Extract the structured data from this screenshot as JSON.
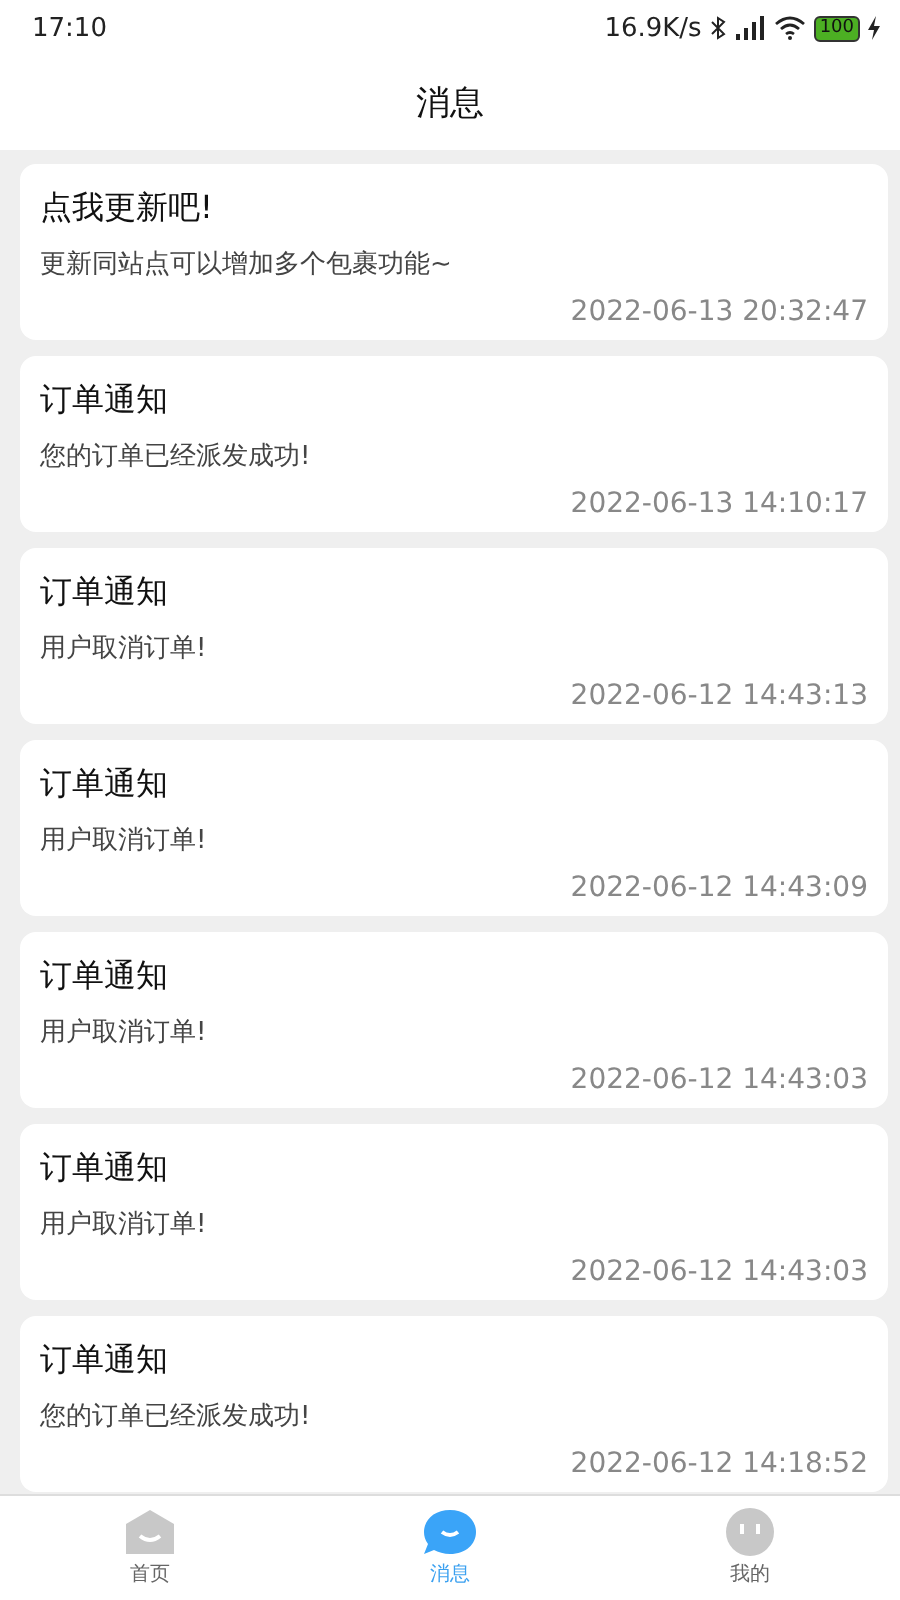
{
  "status_bar": {
    "time": "17:10",
    "speed": "16.9K/s",
    "battery": "100"
  },
  "header": {
    "title": "消息"
  },
  "messages": [
    {
      "title": "点我更新吧!",
      "body": "更新同站点可以增加多个包裹功能~",
      "time": "2022-06-13 20:32:47"
    },
    {
      "title": "订单通知",
      "body": "您的订单已经派发成功!",
      "time": "2022-06-13 14:10:17"
    },
    {
      "title": "订单通知",
      "body": "用户取消订单!",
      "time": "2022-06-12 14:43:13"
    },
    {
      "title": "订单通知",
      "body": "用户取消订单!",
      "time": "2022-06-12 14:43:09"
    },
    {
      "title": "订单通知",
      "body": "用户取消订单!",
      "time": "2022-06-12 14:43:03"
    },
    {
      "title": "订单通知",
      "body": "用户取消订单!",
      "time": "2022-06-12 14:43:03"
    },
    {
      "title": "订单通知",
      "body": "您的订单已经派发成功!",
      "time": "2022-06-12 14:18:52"
    }
  ],
  "nav": [
    {
      "kind": "home",
      "label": "首页",
      "selected": false
    },
    {
      "kind": "messages",
      "label": "消息",
      "selected": true
    },
    {
      "kind": "profile",
      "label": "我的",
      "selected": false
    }
  ]
}
